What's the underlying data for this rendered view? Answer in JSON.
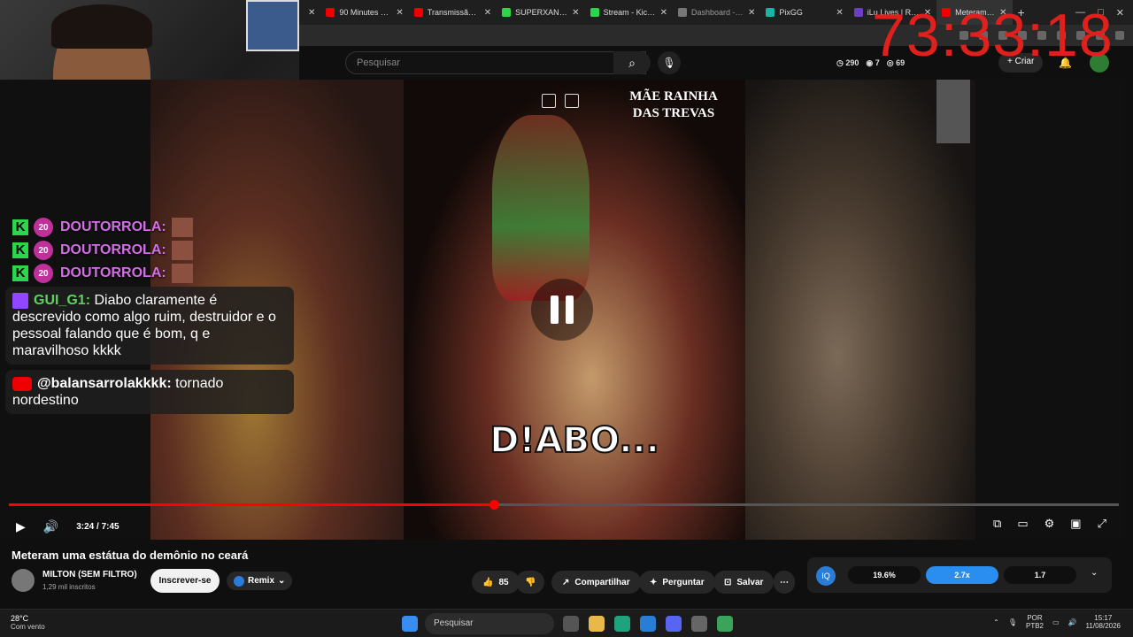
{
  "browser": {
    "tabs": [
      {
        "label": "90 Minutes Of M",
        "color": "#e00"
      },
      {
        "label": "Transmissão ao",
        "color": "#e00"
      },
      {
        "label": "SUPERXANDAO",
        "color": "#2bd64a"
      },
      {
        "label": "Stream - Kick Da",
        "color": "#2bd64a"
      },
      {
        "label": "Dashboard - Un",
        "color": "#777"
      },
      {
        "label": "PixGG",
        "color": "#18b4a5"
      },
      {
        "label": "iLu Lives | React",
        "color": "#6a3fc4"
      },
      {
        "label": "Meteram um",
        "color": "#e00"
      }
    ]
  },
  "youtube": {
    "search_placeholder": "Pesquisar",
    "stats": [
      "290",
      "7",
      "69"
    ],
    "create_label": "Criar"
  },
  "timer": "73:33:18",
  "chat": {
    "spam": [
      {
        "badge": "20",
        "user": "DOUTORROLA:"
      },
      {
        "badge": "20",
        "user": "DOUTORROLA:"
      },
      {
        "badge": "20",
        "user": "DOUTORROLA:"
      }
    ],
    "twitch_user": "GUI_G1:",
    "twitch_msg": "Diabo claramente é descrevido como algo ruim, destruidor e o pessoal falando que é bom, q e maravilhoso kkkk",
    "yt_user": "@balansarrolakkkk:",
    "yt_msg": "tornado nordestino"
  },
  "video": {
    "overlay_title": "MÃE RAINHA DAS TREVAS",
    "caption": "D!ABO...",
    "time": "3:24 / 7:45",
    "progress_fraction": 0.437
  },
  "below": {
    "title": "Meteram uma estátua do demônio no ceará",
    "channel": "MILTON (SEM FILTRO)",
    "subs": "1,29 mil inscritos",
    "subscribe": "Inscrever-se",
    "remix": "Remix",
    "likes": "85",
    "share": "Compartilhar",
    "ask": "Perguntar",
    "save": "Salvar",
    "speeds": [
      "19.6%",
      "2.7x",
      "1.7"
    ]
  },
  "taskbar": {
    "temp": "28°C",
    "weather": "Com vento",
    "search": "Pesquisar",
    "lang1": "POR",
    "lang2": "PTB2",
    "time": "15:17",
    "date": "11/08/2026"
  }
}
